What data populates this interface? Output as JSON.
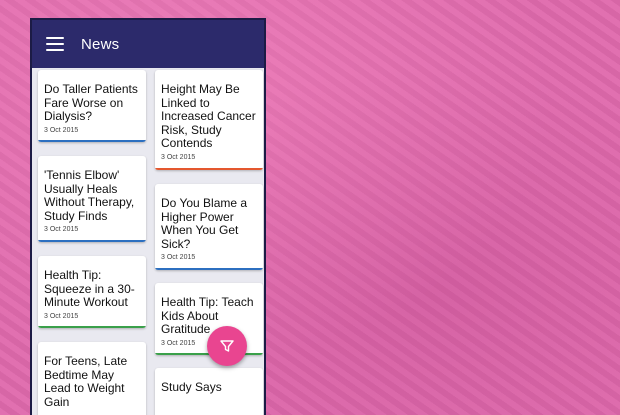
{
  "app": {
    "title": "News"
  },
  "colors": {
    "appbar": "#2c2a6b",
    "fab": "#e94590",
    "accent_blue": "#2c6fc0",
    "accent_orange": "#e4572e",
    "accent_green": "#3aa04a"
  },
  "cards": [
    {
      "title": "Do Taller Patients Fare Worse on Dialysis?",
      "date": "3 Oct 2015",
      "accent": "#2c6fc0"
    },
    {
      "title": "'Tennis Elbow' Usually Heals Without Therapy, Study Finds",
      "date": "3 Oct 2015",
      "accent": "#2c6fc0"
    },
    {
      "title": "Health Tip: Squeeze in a 30-Minute Workout",
      "date": "3 Oct 2015",
      "accent": "#3aa04a"
    },
    {
      "title": "For Teens, Late Bedtime May Lead to Weight Gain",
      "date": "",
      "accent": "#2c6fc0"
    },
    {
      "title": "Height May Be Linked to Increased Cancer Risk, Study Contends",
      "date": "3 Oct 2015",
      "accent": "#e4572e"
    },
    {
      "title": "Do You Blame a Higher Power When You Get Sick?",
      "date": "3 Oct 2015",
      "accent": "#2c6fc0"
    },
    {
      "title": "Health Tip: Teach Kids About Gratitude",
      "date": "3 Oct 2015",
      "accent": "#3aa04a"
    },
    {
      "title": "Study Says",
      "date": "",
      "accent": "#2c6fc0"
    }
  ],
  "fab": {
    "icon": "filter-icon"
  }
}
